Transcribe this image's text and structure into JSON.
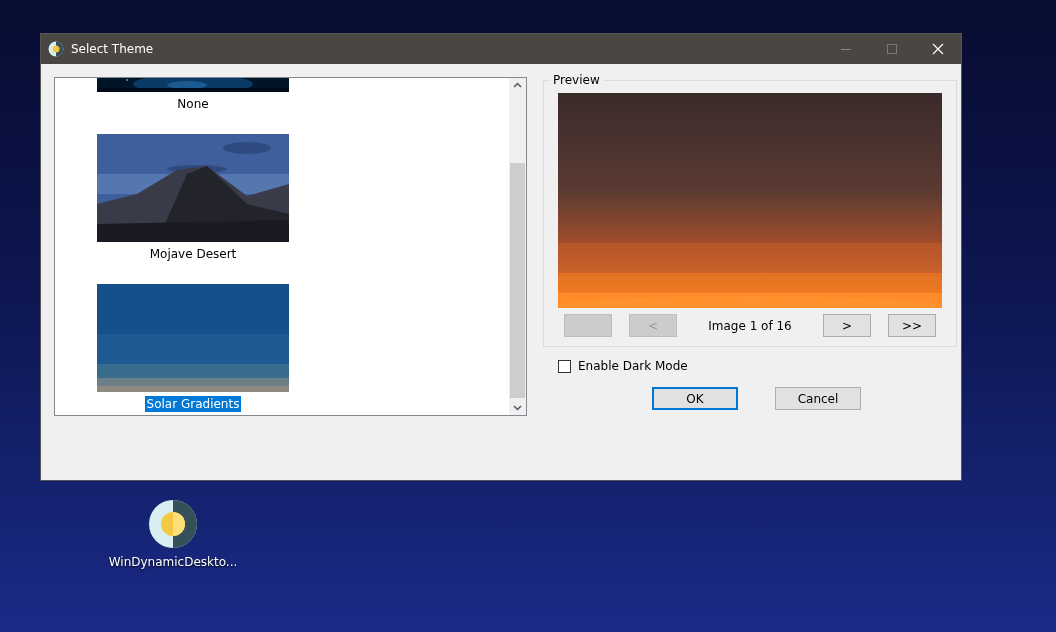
{
  "window": {
    "title": "Select Theme"
  },
  "themes": [
    {
      "name": "None",
      "selected": false
    },
    {
      "name": "Mojave Desert",
      "selected": false
    },
    {
      "name": "Solar Gradients",
      "selected": true
    }
  ],
  "preview": {
    "label": "Preview",
    "counter": "Image 1 of 16",
    "nav_buttons": [
      {
        "disabled": true
      },
      {
        "label": "<",
        "disabled": true
      },
      {
        "label": ">",
        "disabled": false
      },
      {
        "label": ">>",
        "disabled": false
      }
    ]
  },
  "dark_mode": {
    "label": "Enable Dark Mode",
    "checked": false
  },
  "buttons": [
    {
      "label": "OK",
      "default": true
    },
    {
      "label": "Cancel",
      "default": false
    }
  ],
  "desktop_icon": {
    "label": "WinDynamicDeskto..."
  }
}
